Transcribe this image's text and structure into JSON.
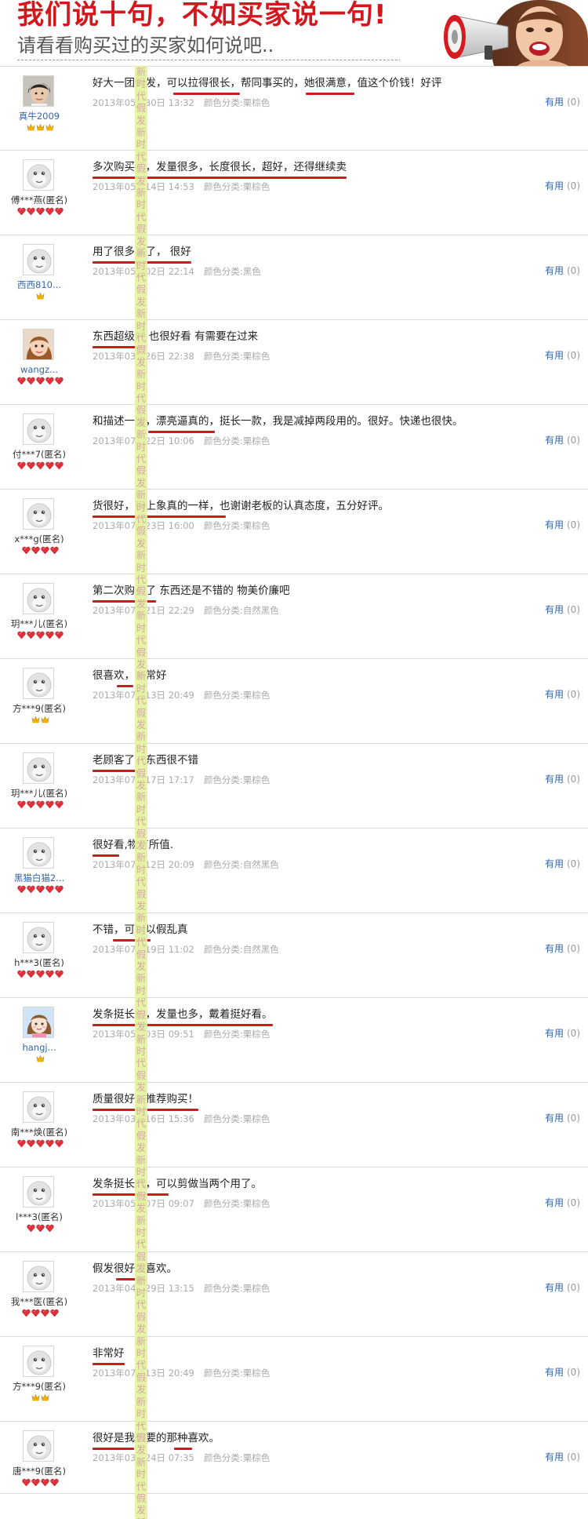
{
  "banner": {
    "headline": "我们说十句，不如买家说一句!",
    "subheadline": "请看看购买过的买家如何说吧..",
    "photo": "woman-with-megaphone"
  },
  "watermark": {
    "text": "新时代假发新时代假发新时代假发新时代假发新时代假发新时代假发新时代假发新时代假发新时代假发新时代假发新时代假发新时代假发新时代假发新时代假发新时代假发新时代假发新时代假发新时代假发新时代假发新时代假发新时代假发新时代假发新时代假发新时代假发新时代假发新时代假发新时代假发新时代假发新时代假发新时代假发新时代假发新时代假发"
  },
  "colors": {
    "headline_red": "#d4161d",
    "underline_red": "#cc1d1d",
    "link_blue": "#3366aa",
    "watermark_green": "#e5f39e",
    "gold_crown": "#f5b400",
    "red_heart": "#e0303a"
  },
  "reviews": [
    {
      "user": "真牛2009",
      "avatar": "photo-boy",
      "rank_icon": "gold-crown",
      "rank_count": 3,
      "text": "好大一团假发，可以拉得很长，帮同事买的，她很满意，值这个价钱！好评",
      "date": "2013年05月30日 13:32",
      "option": "颜色分类:栗棕色",
      "helpful_label": "有用",
      "helpful_count": "(0)"
    },
    {
      "user": "傅***燕(匿名)",
      "avatar": "default-face",
      "rank_icon": "red-heart",
      "rank_count": 5,
      "text": "多次购买了，发量很多，长度很长，超好，还得继续卖",
      "date": "2013年05月14日 14:53",
      "option": "颜色分类:栗棕色",
      "helpful_label": "有用",
      "helpful_count": "(0)"
    },
    {
      "user": "西西810...",
      "avatar": "default-face",
      "rank_icon": "gold-crown",
      "rank_count": 1,
      "text": "用了很多次了， 很好",
      "date": "2013年05月02日 22:14",
      "option": "颜色分类:黑色",
      "helpful_label": "有用",
      "helpful_count": "(0)"
    },
    {
      "user": "wangz...",
      "avatar": "photo-girl",
      "rank_icon": "red-heart",
      "rank_count": 5,
      "text": "东西超级好 也很好看 有需要在过来",
      "date": "2013年03月26日 22:38",
      "option": "颜色分类:栗棕色",
      "helpful_label": "有用",
      "helpful_count": "(0)"
    },
    {
      "user": "付***7(匿名)",
      "avatar": "default-face",
      "rank_icon": "red-heart",
      "rank_count": 5,
      "text": "和描述一致，漂亮逼真的，挺长一款，我是减掉两段用的。很好。快递也很快。",
      "date": "2013年07月22日 10:06",
      "option": "颜色分类:栗棕色",
      "helpful_label": "有用",
      "helpful_count": "(0)"
    },
    {
      "user": "x***g(匿名)",
      "avatar": "default-face",
      "rank_icon": "red-heart",
      "rank_count": 4,
      "text": "货很好，带上象真的一样，也谢谢老板的认真态度，五分好评。",
      "date": "2013年07月23日 16:00",
      "option": "颜色分类:栗棕色",
      "helpful_label": "有用",
      "helpful_count": "(0)"
    },
    {
      "user": "玥***儿(匿名)",
      "avatar": "default-face",
      "rank_icon": "red-heart",
      "rank_count": 5,
      "text": "第二次购买了 东西还是不错的 物美价廉吧",
      "date": "2013年07月21日 22:29",
      "option": "颜色分类:自然黑色",
      "helpful_label": "有用",
      "helpful_count": "(0)"
    },
    {
      "user": "方***9(匿名)",
      "avatar": "default-face",
      "rank_icon": "gold-crown",
      "rank_count": 2,
      "text": "很喜欢，非常好",
      "date": "2013年07月13日 20:49",
      "option": "颜色分类:栗棕色",
      "helpful_label": "有用",
      "helpful_count": "(0)"
    },
    {
      "user": "玥***儿(匿名)",
      "avatar": "default-face",
      "rank_icon": "red-heart",
      "rank_count": 5,
      "text": "老顾客了，东西很不错",
      "date": "2013年07月17日 17:17",
      "option": "颜色分类:栗棕色",
      "helpful_label": "有用",
      "helpful_count": "(0)"
    },
    {
      "user": "黑猫白猫2...",
      "avatar": "default-face",
      "rank_icon": "red-heart",
      "rank_count": 5,
      "text": "很好看,物有所值.",
      "date": "2013年07月12日 20:09",
      "option": "颜色分类:自然黑色",
      "helpful_label": "有用",
      "helpful_count": "(0)"
    },
    {
      "user": "h***3(匿名)",
      "avatar": "default-face",
      "rank_icon": "red-heart",
      "rank_count": 5,
      "text": "不错，可以以假乱真",
      "date": "2013年07月19日 11:02",
      "option": "颜色分类:自然黑色",
      "helpful_label": "有用",
      "helpful_count": "(0)"
    },
    {
      "user": "hangj...",
      "avatar": "photo-cartoon-girl",
      "rank_icon": "gold-crown",
      "rank_count": 1,
      "text": "发条挺长的，发量也多，戴着挺好看。",
      "date": "2013年05月03日 09:51",
      "option": "颜色分类:栗棕色",
      "helpful_label": "有用",
      "helpful_count": "(0)"
    },
    {
      "user": "南***焕(匿名)",
      "avatar": "default-face",
      "rank_icon": "red-heart",
      "rank_count": 5,
      "text": "质量很好，推荐购买！",
      "date": "2013年03月16日 15:36",
      "option": "颜色分类:栗棕色",
      "helpful_label": "有用",
      "helpful_count": "(0)"
    },
    {
      "user": "l***3(匿名)",
      "avatar": "default-face",
      "rank_icon": "red-heart",
      "rank_count": 3,
      "text": "发条挺长的，可以剪做当两个用了。",
      "date": "2013年05月07日 09:07",
      "option": "颜色分类:栗棕色",
      "helpful_label": "有用",
      "helpful_count": "(0)"
    },
    {
      "user": "我***医(匿名)",
      "avatar": "default-face",
      "rank_icon": "red-heart",
      "rank_count": 4,
      "text": "假发很好超喜欢。",
      "date": "2013年04月29日 13:15",
      "option": "颜色分类:栗棕色",
      "helpful_label": "有用",
      "helpful_count": "(0)"
    },
    {
      "user": "方***9(匿名)",
      "avatar": "default-face",
      "rank_icon": "gold-crown",
      "rank_count": 2,
      "text": "非常好",
      "date": "2013年07月13日 20:49",
      "option": "颜色分类:栗棕色",
      "helpful_label": "有用",
      "helpful_count": "(0)"
    },
    {
      "user": "唐***9(匿名)",
      "avatar": "default-face",
      "rank_icon": "red-heart",
      "rank_count": 4,
      "text": "很好是我想要的那种喜欢。",
      "date": "2013年03月24日 07:35",
      "option": "颜色分类:栗棕色",
      "helpful_label": "有用",
      "helpful_count": "(0)"
    }
  ]
}
